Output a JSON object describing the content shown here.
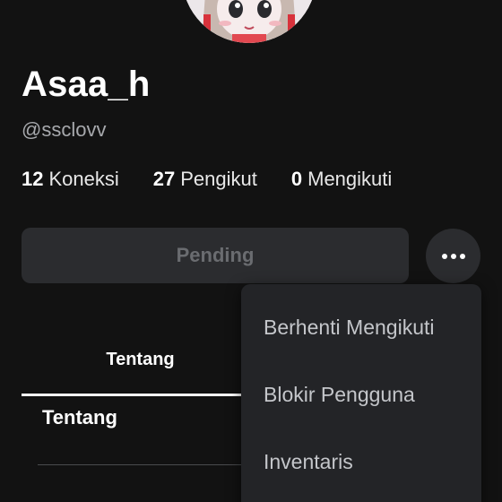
{
  "profile": {
    "display_name": "Asaa_h",
    "username": "@ssclovv"
  },
  "stats": [
    {
      "count": "12",
      "label": "Koneksi"
    },
    {
      "count": "27",
      "label": "Pengikut"
    },
    {
      "count": "0",
      "label": "Mengikuti"
    }
  ],
  "actions": {
    "pending_label": "Pending",
    "more_icon": "ellipsis-icon"
  },
  "tabs": {
    "about_label": "Tentang"
  },
  "section": {
    "title": "Tentang"
  },
  "menu": {
    "items": [
      {
        "label": "Berhenti Mengikuti"
      },
      {
        "label": "Blokir Pengguna"
      },
      {
        "label": "Inventaris"
      }
    ]
  },
  "colors": {
    "background": "#121212",
    "button_bg": "#2b2c2f",
    "menu_bg": "#232427",
    "muted_text": "#a7a9ad",
    "disabled_text": "#6a6c70"
  }
}
